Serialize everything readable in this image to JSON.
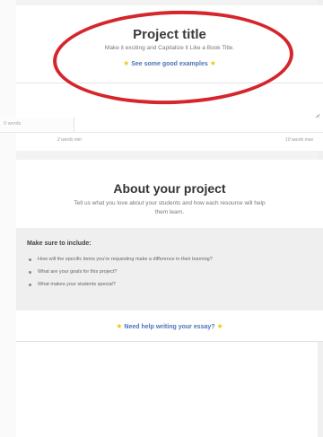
{
  "project": {
    "title": "Project title",
    "subtitle": "Make it exciting and Capitalize it Like a Book Title.",
    "examples_link": "See some good examples",
    "word_count": "0 words",
    "min_label": "2 words min",
    "max_label": "10 words max"
  },
  "about": {
    "title": "About your project",
    "subtitle": "Tell us what you love about your students and how each resource will help them learn.",
    "include_title": "Make sure to include:",
    "include_items": [
      "How will the specific items you're requesting make a difference in their learning?",
      "What are your goals for this project?",
      "What makes your students special?"
    ],
    "help_link": "Need help writing your essay?"
  },
  "icons": {
    "star": "★"
  },
  "colors": {
    "link": "#4a73b8",
    "star": "#f2c414",
    "annotation_oval": "#d4262c"
  }
}
